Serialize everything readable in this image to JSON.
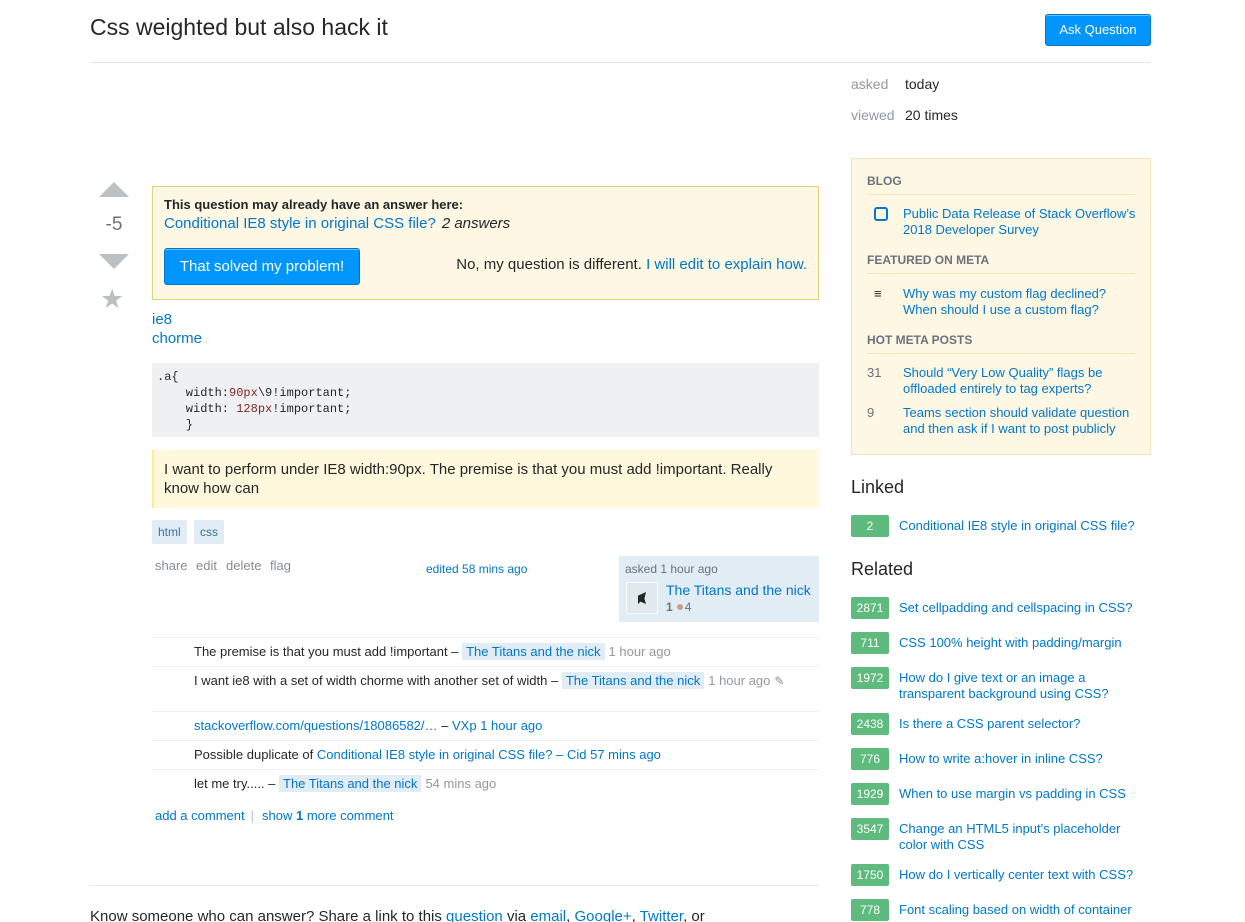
{
  "header": {
    "title": "Css weighted but also hack it",
    "ask_button": "Ask Question"
  },
  "stats": {
    "asked_label": "asked",
    "asked_value": "today",
    "viewed_label": "viewed",
    "viewed_value": "20 times"
  },
  "vote": {
    "count": "-5"
  },
  "duplicate": {
    "title": "This question may already have an answer here:",
    "link": "Conditional IE8 style in original CSS file?",
    "answers": "2 answers",
    "solved_button": "That solved my problem!",
    "different_text": "No, my question is different.",
    "edit_link": "I will edit to explain how."
  },
  "body": {
    "lines": [
      "ie8",
      "chorme"
    ],
    "code": {
      "l1": ".a{",
      "l2_a": "    width:",
      "l2_num": "90px",
      "l2_b": "\\9!important;",
      "l3_a": "    width: ",
      "l3_num": "128px",
      "l3_b": "!important;",
      "l4": "    }"
    },
    "quote": "I want to perform under IE8 width:90px. The premise is that you must add !important. Really know how can"
  },
  "tags": [
    "html",
    "css"
  ],
  "post_menu": [
    "share",
    "edit",
    "delete",
    "flag"
  ],
  "edited": "edited 58 mins ago",
  "owner": {
    "action": "asked 1 hour ago",
    "name": "The Titans and the nick",
    "rep": "1",
    "bronze": "4"
  },
  "comments": [
    {
      "text": "The premise is that you must add !important –",
      "user": "The Titans and the nick",
      "date": "1 hour ago"
    },
    {
      "text": "I want ie8 with a set of width chorme with another set of width –",
      "user": "The Titans and the nick",
      "date": "1 hour ago",
      "pencil": "✎"
    },
    {
      "link": "stackoverflow.com/questions/18086582/…",
      "dash": "–",
      "user": "VXp",
      "date": "1 hour ago"
    },
    {
      "prefix": "Possible duplicate of",
      "link": "Conditional IE8 style in original CSS file?",
      "dash": "–",
      "user": "Cid",
      "date": "57 mins ago"
    },
    {
      "text": "let me try..... –",
      "user": "The Titans and the nick",
      "date": "54 mins ago"
    }
  ],
  "comment_actions": {
    "add": "add a comment",
    "sep": "|",
    "show_pre": "show",
    "show_num": "1",
    "show_post": "more comment"
  },
  "share": {
    "prefix": "Know someone who can answer? Share a link to this",
    "question": "question",
    "via": "via",
    "email": "email",
    "google": "Google+",
    "twitter": "Twitter",
    "or": "or"
  },
  "sidebar": {
    "blog_head": "BLOG",
    "blog_item": "Public Data Release of Stack Overflow’s 2018 Developer Survey",
    "meta_head": "FEATURED ON META",
    "meta_item": "Why was my custom flag declined? When should I use a custom flag?",
    "hot_head": "HOT META POSTS",
    "hot": [
      {
        "count": "31",
        "title": "Should “Very Low Quality” flags be offloaded entirely to tag experts?"
      },
      {
        "count": "9",
        "title": "Teams section should validate question and then ask if I want to post publicly"
      }
    ]
  },
  "linked": {
    "heading": "Linked",
    "items": [
      {
        "score": "2",
        "title": "Conditional IE8 style in original CSS file?"
      }
    ]
  },
  "related": {
    "heading": "Related",
    "items": [
      {
        "score": "2871",
        "title": "Set cellpadding and cellspacing in CSS?"
      },
      {
        "score": "711",
        "title": "CSS 100% height with padding/margin"
      },
      {
        "score": "1972",
        "title": "How do I give text or an image a transparent background using CSS?"
      },
      {
        "score": "2438",
        "title": "Is there a CSS parent selector?"
      },
      {
        "score": "776",
        "title": "How to write a:hover in inline CSS?"
      },
      {
        "score": "1929",
        "title": "When to use margin vs padding in CSS"
      },
      {
        "score": "3547",
        "title": "Change an HTML5 input's placeholder color with CSS"
      },
      {
        "score": "1750",
        "title": "How do I vertically center text with CSS?"
      },
      {
        "score": "778",
        "title": "Font scaling based on width of container"
      }
    ]
  },
  "colors": {
    "accent": "#0095ff",
    "link": "#0077cc",
    "answered_badge": "#5eba7d",
    "notice_bg": "#fdf7e3"
  }
}
